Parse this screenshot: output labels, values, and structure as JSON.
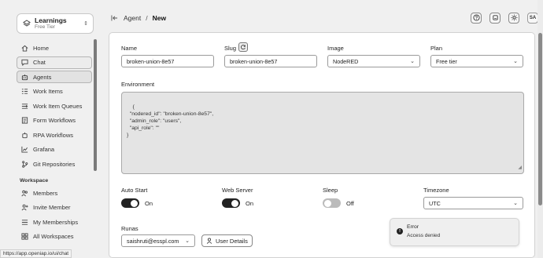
{
  "org": {
    "name": "Learnings",
    "tier": "Free Tier"
  },
  "nav": [
    {
      "label": "Home",
      "icon": "home-icon"
    },
    {
      "label": "Chat",
      "icon": "chat-icon"
    },
    {
      "label": "Agents",
      "icon": "agents-icon"
    },
    {
      "label": "Work Items",
      "icon": "work-items-icon"
    },
    {
      "label": "Work Item Queues",
      "icon": "queues-icon"
    },
    {
      "label": "Form Workflows",
      "icon": "form-icon"
    },
    {
      "label": "RPA Workflows",
      "icon": "rpa-icon"
    },
    {
      "label": "Grafana",
      "icon": "chart-icon"
    },
    {
      "label": "Git Repositories",
      "icon": "git-icon"
    }
  ],
  "workspace": {
    "heading": "Workspace",
    "items": [
      {
        "label": "Members",
        "icon": "members-icon"
      },
      {
        "label": "Invite Member",
        "icon": "invite-icon"
      },
      {
        "label": "My Memberships",
        "icon": "memberships-icon"
      },
      {
        "label": "All Workspaces",
        "icon": "workspaces-icon"
      }
    ]
  },
  "status_url": "https://app.openiap.io/ui/chat",
  "breadcrumb": {
    "parent": "Agent",
    "separator": "/",
    "current": "New"
  },
  "user_initials": "SA",
  "form": {
    "name_label": "Name",
    "name_value": "broken-union-8e57",
    "slug_label": "Slug",
    "slug_value": "broken-union-8e57",
    "image_label": "Image",
    "image_value": "NodeRED",
    "plan_label": "Plan",
    "plan_value": "Free tier",
    "environment_label": "Environment",
    "environment_value": "{\n  \"nodered_id\": \"broken-union-8e57\",\n  \"admin_role\": \"users\",\n  \"api_role\": \"\"\n}",
    "auto_start_label": "Auto Start",
    "auto_start_state": "On",
    "web_server_label": "Web Server",
    "web_server_state": "On",
    "sleep_label": "Sleep",
    "sleep_state": "Off",
    "timezone_label": "Timezone",
    "timezone_value": "UTC",
    "runas_label": "Runas",
    "runas_value": "saishruti@esspl.com",
    "user_details_label": "User Details"
  },
  "toast": {
    "title": "Error",
    "message": "Access denied"
  }
}
